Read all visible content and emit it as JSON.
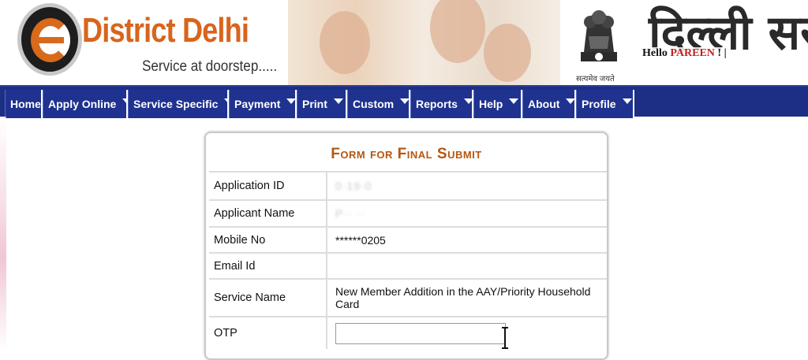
{
  "header": {
    "logo_title": "District Delhi",
    "logo_tagline": "Service at doorstep.....",
    "emblem_caption": "सत्यमेव जयते",
    "hindi_title": "दिल्ली सर",
    "greeting_prefix": "Hello",
    "greeting_user": "PAREEN",
    "greeting_suffix": "!   |"
  },
  "nav": {
    "items": [
      {
        "label": "Home",
        "has_caret": false
      },
      {
        "label": "Apply Online",
        "has_caret": true
      },
      {
        "label": "Service Specific",
        "has_caret": true
      },
      {
        "label": "Payment",
        "has_caret": true
      },
      {
        "label": "Print",
        "has_caret": true
      },
      {
        "label": "Custom",
        "has_caret": true
      },
      {
        "label": "Reports",
        "has_caret": true
      },
      {
        "label": "Help",
        "has_caret": true
      },
      {
        "label": "About",
        "has_caret": true
      },
      {
        "label": "Profile",
        "has_caret": true
      }
    ]
  },
  "form": {
    "title": "Form for Final Submit",
    "rows": [
      {
        "label": "Application ID",
        "value": "0·19·0"
      },
      {
        "label": "Applicant Name",
        "value": "P·· ··"
      },
      {
        "label": "Mobile No",
        "value": "******0205"
      },
      {
        "label": "Email Id",
        "value": ""
      },
      {
        "label": "Service Name",
        "value": "New Member Addition in the AAY/Priority Household Card"
      },
      {
        "label": "OTP",
        "value": ""
      }
    ]
  },
  "colors": {
    "brand_orange": "#d9641c",
    "nav_blue": "#1d2f84",
    "form_title": "#b5560f",
    "user_red": "#c0201f"
  }
}
